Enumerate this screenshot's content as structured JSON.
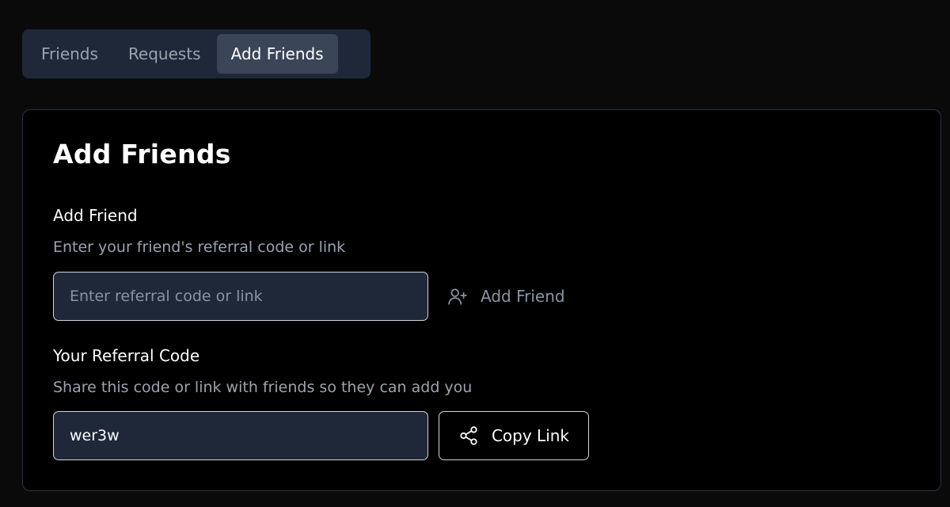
{
  "tabs": [
    {
      "label": "Friends",
      "active": false
    },
    {
      "label": "Requests",
      "active": false
    },
    {
      "label": "Add Friends",
      "active": true
    }
  ],
  "card": {
    "title": "Add Friends",
    "add_friend": {
      "label": "Add Friend",
      "description": "Enter your friend's referral code or link",
      "input_placeholder": "Enter referral code or link",
      "input_value": "",
      "button_label": "Add Friend",
      "button_icon": "user-plus-icon"
    },
    "referral": {
      "label": "Your Referral Code",
      "description": "Share this code or link with friends so they can add you",
      "code_value": "wer3w",
      "button_label": "Copy Link",
      "button_icon": "share-icon"
    }
  },
  "colors": {
    "background": "#0a0a0a",
    "tab_bar": "#1e2838",
    "tab_active": "#3a4558",
    "input_bg": "#1e2838",
    "muted_text": "#9ca3af"
  }
}
